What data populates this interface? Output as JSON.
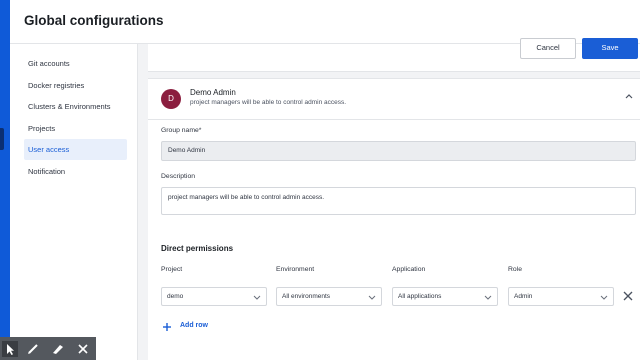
{
  "header": {
    "title": "Global configurations"
  },
  "sidebar": {
    "items": [
      {
        "label": "Git accounts"
      },
      {
        "label": "Docker registries"
      },
      {
        "label": "Clusters & Environments"
      },
      {
        "label": "Projects"
      },
      {
        "label": "User access",
        "active": true
      },
      {
        "label": "Notification"
      }
    ]
  },
  "actions": {
    "cancel_label": "Cancel",
    "save_label": "Save"
  },
  "group": {
    "avatar_letter": "D",
    "avatar_color": "#8b1e3f",
    "name": "Demo Admin",
    "summary": "project managers will be able to control admin access.",
    "name_label": "Group name*",
    "name_value": "Demo Admin",
    "description_label": "Description",
    "description_value": "project managers will be able to control admin access."
  },
  "permissions": {
    "title": "Direct permissions",
    "columns": [
      "Project",
      "Environment",
      "Application",
      "Role"
    ],
    "rows": [
      {
        "project": "demo",
        "environment": "All environments",
        "application": "All applications",
        "role": "Admin"
      }
    ],
    "add_row_label": "Add row"
  },
  "colors": {
    "accent": "#1a5ed6",
    "strip": "#0f5ad8",
    "toolbar": "#54585e"
  },
  "toolbar_icons": [
    "cursor-icon",
    "pen-icon",
    "highlighter-icon",
    "close-icon"
  ]
}
